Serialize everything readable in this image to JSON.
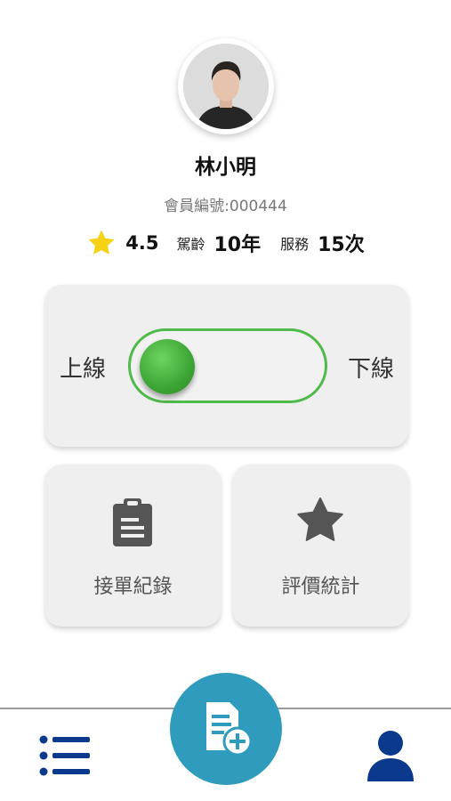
{
  "profile": {
    "name": "林小明",
    "member_id": "會員編號:000444",
    "rating": "4.5",
    "driving_label": "駕齡",
    "driving_value": "10年",
    "service_label": "服務",
    "service_value": "15次"
  },
  "status_toggle": {
    "on_label": "上線",
    "off_label": "下線",
    "position": "on"
  },
  "tiles": {
    "records_label": "接單紀錄",
    "records_icon": "clipboard-icon",
    "ratings_label": "評價統計",
    "ratings_icon": "star-icon"
  },
  "bottom_nav": {
    "left_icon": "list-icon",
    "center_icon": "add-document-icon",
    "right_icon": "user-icon"
  },
  "colors": {
    "star": "#f5d213",
    "toggle_green": "#4fb94a",
    "fab": "#2f9cbd",
    "nav_icon": "#0b3a8c",
    "tile_icon": "#555555"
  }
}
